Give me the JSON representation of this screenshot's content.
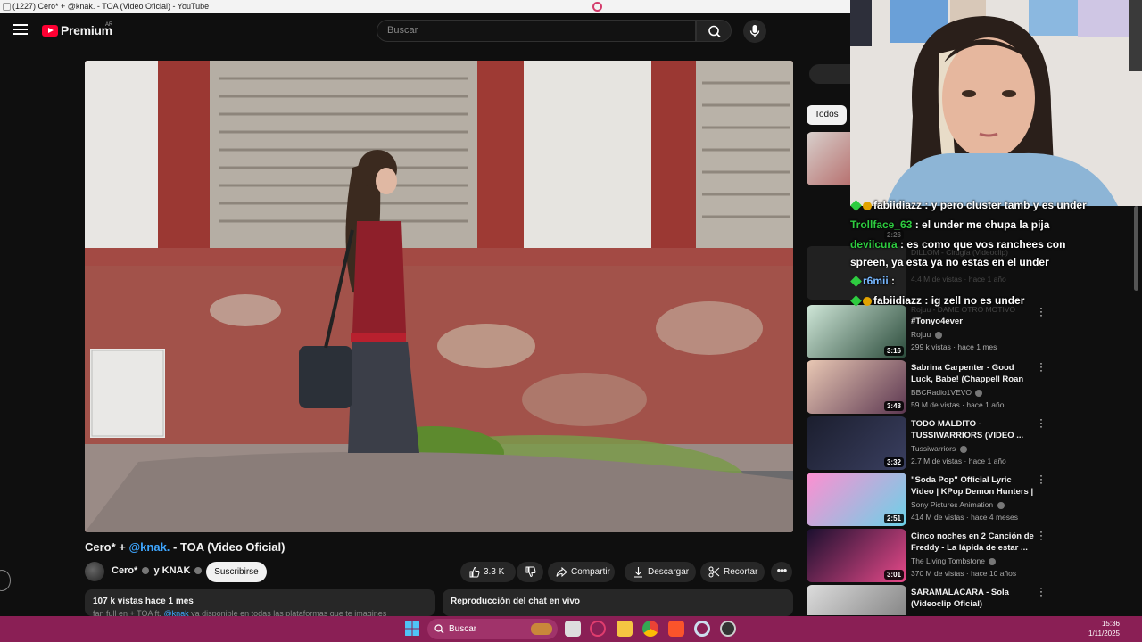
{
  "window": {
    "title": "(1227) Cero* + @knak. - TOA (Video Oficial) - YouTube"
  },
  "header": {
    "logo_text": "Premium",
    "country": "AR",
    "search_placeholder": "Buscar"
  },
  "video": {
    "title_prefix": "Cero* + ",
    "title_mention": "@knak.",
    "title_suffix": " - TOA (Video Oficial)",
    "channel": "Cero* ",
    "channel_and": " y KNAK ",
    "subscribe_label": "Suscribirse",
    "like_count": "3.3 K",
    "share_label": "Compartir",
    "download_label": "Descargar",
    "clip_label": "Recortar",
    "more_label": "•••",
    "views_line": "107 k vistas  hace 1 mes",
    "desc_prefix": "fan full en + TOA ft. ",
    "desc_mention": "@knak",
    "desc_suffix": " ya disponible en todas las plataformas que te imagines",
    "chat_replay_label": "Reproducción del chat en vivo"
  },
  "sidebar": {
    "chip_all": "Todos",
    "recommendations": [
      {
        "title": "",
        "channel": "",
        "meta": "",
        "duration": ""
      },
      {
        "title": "DILLOM - Cirugía (Videoclip)",
        "channel": "",
        "meta": "",
        "duration": "2:26"
      },
      {
        "title": "Rojuu - DAME OTRO MOTIVO",
        "channel": "",
        "meta": "4.4 M de vistas · hace 1 año",
        "duration": ""
      },
      {
        "title": "#Tonyo4ever",
        "channel": "Rojuu",
        "meta": "299 k vistas · hace 1 mes",
        "duration": "3:16"
      },
      {
        "title": "Sabrina Carpenter - Good Luck, Babe! (Chappell Roan cover) in...",
        "channel": "BBCRadio1VEVO",
        "meta": "59 M de vistas · hace 1 año",
        "duration": "3:48"
      },
      {
        "title": "TODO MALDITO - TUSSIWARRIORS (VIDEO ...",
        "channel": "Tussiwarriors",
        "meta": "2.7 M de vistas · hace 1 año",
        "duration": "3:32"
      },
      {
        "title": "\"Soda Pop\" Official Lyric Video | KPop Demon Hunters | Sony ...",
        "channel": "Sony Pictures Animation",
        "meta": "414 M de vistas · hace 4 meses",
        "duration": "2:51"
      },
      {
        "title": "Cinco noches en 2 Canción de Freddy - La lápida de estar ...",
        "channel": "The Living Tombstone",
        "meta": "370 M de vistas · hace 10 años",
        "duration": "3:01"
      },
      {
        "title": "SARAMALACARA - Sola (Videoclip Oficial)",
        "channel": "",
        "meta": "",
        "duration": ""
      }
    ]
  },
  "chat": {
    "messages": [
      {
        "user": "fabiidiazz",
        "text": " y pero cluster tamb y es under"
      },
      {
        "user": "Trollface_63",
        "text": " el under me chupa la pija"
      },
      {
        "user": "devilcura",
        "text": " es como que vos ranchees con"
      },
      {
        "user": "",
        "text": "spreen, ya esta ya no estas en el under"
      },
      {
        "user": "r6mii",
        "text": " :"
      },
      {
        "user": "fabiidiazz",
        "text": " ig zell no es under"
      }
    ]
  },
  "taskbar": {
    "search_label": "Buscar",
    "time": "15:36",
    "date": "1/11/2025"
  },
  "colors": {
    "accent_red": "#ff0033",
    "link_blue": "#3ea6ff",
    "taskbar": "#8a1f55"
  }
}
